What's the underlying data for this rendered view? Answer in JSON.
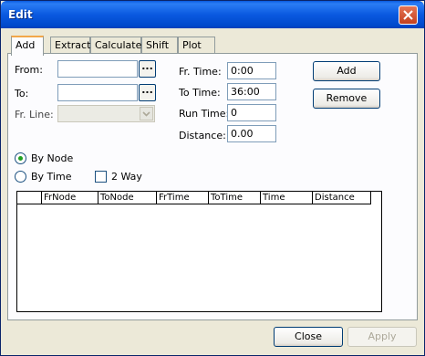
{
  "window": {
    "title": "Edit",
    "close_icon": "close-icon"
  },
  "tabs": [
    {
      "label": "Add",
      "active": true
    },
    {
      "label": "Extract",
      "active": false
    },
    {
      "label": "Calculate",
      "active": false
    },
    {
      "label": "Shift",
      "active": false
    },
    {
      "label": "Plot",
      "active": false
    }
  ],
  "form": {
    "from_label": "From:",
    "from_value": "",
    "from_browse": "...",
    "to_label": "To:",
    "to_value": "",
    "to_browse": "...",
    "fr_line_label": "Fr. Line:",
    "fr_line_value": "",
    "fr_time_label": "Fr. Time:",
    "fr_time_value": "0:00",
    "to_time_label": "To Time:",
    "to_time_value": "36:00",
    "run_time_label": "Run Time:",
    "run_time_value": "0",
    "distance_label": "Distance:",
    "distance_value": "0.00",
    "add_button": "Add",
    "remove_button": "Remove"
  },
  "options": {
    "by_node_label": "By Node",
    "by_node_checked": true,
    "by_time_label": "By Time",
    "by_time_checked": false,
    "two_way_label": "2 Way",
    "two_way_checked": false
  },
  "grid": {
    "columns": [
      "",
      "FrNode",
      "ToNode",
      "FrTime",
      "ToTime",
      "Time",
      "Distance"
    ],
    "rows": []
  },
  "footer": {
    "close_button": "Close",
    "apply_button": "Apply"
  }
}
